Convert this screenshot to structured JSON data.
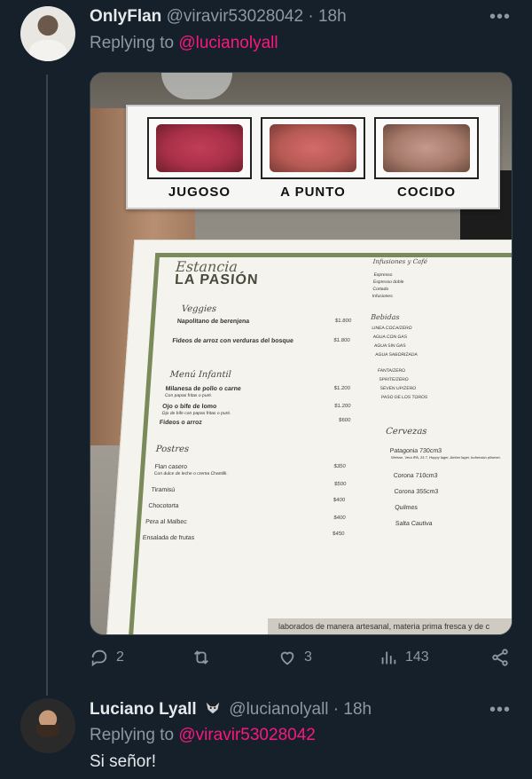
{
  "tweet": {
    "author_name": "OnlyFlan",
    "author_handle": "@viravir53028042",
    "time": "· 18h",
    "replying_label": "Replying to",
    "replying_to": "@lucianolyall",
    "media": {
      "card_labels": [
        "JUGOSO",
        "A PUNTO",
        "COCIDO"
      ],
      "menu": {
        "logo_script": "Estancia",
        "logo_name": "LA PASIÓN",
        "section_veggies": "Veggies",
        "veg_item_1": "Napolitano de berenjena",
        "veg_item_2": "Fideos de arroz con verduras del bosque",
        "veg_price_1": "$1.800",
        "veg_price_2": "$1.800",
        "section_infantil": "Menú Infantil",
        "inf_item_1": "Milanesa de pollo o carne",
        "inf_item_1_sub": "Con papas fritas o puré.",
        "inf_item_2": "Ojo o bife de lomo",
        "inf_item_2_sub": "Ojo de bife con papas fritas o puré.",
        "inf_item_3": "Fideos o arroz",
        "inf_price_1": "$1.200",
        "inf_price_2": "$1.200",
        "inf_price_3": "$600",
        "section_postres": "Postres",
        "postres": [
          "Flan casero",
          "Tiramisú",
          "Chocotorta",
          "Pera al Malbec",
          "Ensalada de frutas"
        ],
        "flan_sub": "Con dulce de leche o crema Chantilli.",
        "postres_prices": [
          "$350",
          "$500",
          "$400",
          "$400",
          "$450"
        ],
        "section_infusiones": "Infusiones y Café",
        "infusiones": [
          "Espresso",
          "Espresso doble",
          "Cortado",
          "Infusiones"
        ],
        "section_bebidas": "Bebidas",
        "bebidas": [
          "LINEA COCA/ZERO",
          "AGUA CON GAS",
          "AGUA SIN GAS",
          "AGUA SABORIZADA",
          "FANTA/ZERO",
          "SPRITE/ZERO",
          "SEVEN UP/ZERO",
          "PASO DE LOS TOROS"
        ],
        "section_cervezas": "Cervezas",
        "cervezas": [
          "Patagonia 730cm3",
          "Corona 710cm3",
          "Corona 355cm3",
          "Quilmes",
          "Salta Cautiva"
        ],
        "patagonia_sub": "Weisse, Vera IPA, 24.7, Hoppy lager, Amber lager, bohemian pilsener.",
        "footer": "laborados de manera artesanal, materia prima fresca y de c"
      }
    },
    "stats": {
      "replies": "2",
      "likes": "3",
      "views": "143"
    }
  },
  "reply": {
    "author_name": "Luciano Lyall",
    "author_handle": "@lucianolyall",
    "time": "· 18h",
    "replying_label": "Replying to",
    "replying_to": "@viravir53028042",
    "text": "Si señor!"
  },
  "icons": {
    "reply": "reply-icon",
    "retweet": "retweet-icon",
    "like": "heart-icon",
    "views": "views-icon",
    "share": "share-icon",
    "more": "more-icon",
    "badge": "fox-badge-icon"
  },
  "colors": {
    "background": "#15202b",
    "mention": "#f91880",
    "muted": "#8b98a5",
    "text": "#e7e9ea"
  }
}
